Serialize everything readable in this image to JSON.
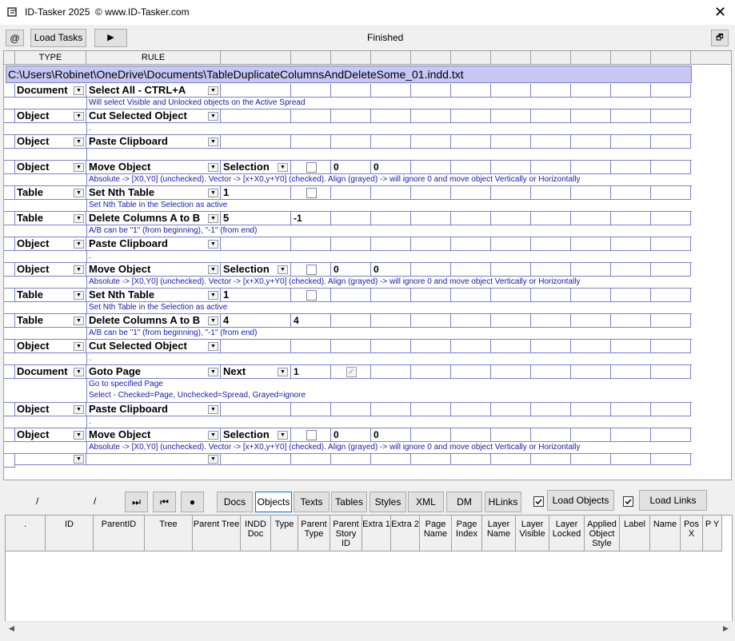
{
  "window": {
    "title": "ID-Tasker 2025  © www.ID-Tasker.com",
    "close": "✕"
  },
  "toolbar": {
    "at": "@",
    "load_tasks": "Load Tasks",
    "run": "▶",
    "status": "Finished",
    "restore": "🗗"
  },
  "grid": {
    "headers": {
      "type": "TYPE",
      "rule": "RULE"
    },
    "filepath": "C:\\Users\\Robinet\\OneDrive\\Documents\\TableDuplicateColumnsAndDeleteSome_01.indd.txt",
    "rows": [
      {
        "type": "Document",
        "rule": "Select All - CTRL+A",
        "desc": "Will select Visible and Unlocked objects on the Active Spread"
      },
      {
        "type": "Object",
        "rule": "Cut Selected Object",
        "desc": "."
      },
      {
        "type": "Object",
        "rule": "Paste Clipboard",
        "desc": ""
      },
      {
        "type": "Object",
        "rule": "Move Object",
        "param": "Selection",
        "v1": "0",
        "v2": "0",
        "desc": "Absolute -> [X0,Y0] (unchecked). Vector -> [x+X0,y+Y0] (checked). Align (grayed) -> will ignore 0 and move object Vertically or Horizontally"
      },
      {
        "type": "Table",
        "rule": "Set Nth Table",
        "param": "1",
        "desc": "Set Nth Table in the Selection as active"
      },
      {
        "type": "Table",
        "rule": "Delete Columns A to B",
        "param": "5",
        "v0": "-1",
        "desc": "A/B can be \"1\" (from beginning), \"-1\" (from end)"
      },
      {
        "type": "Object",
        "rule": "Paste Clipboard",
        "desc": "."
      },
      {
        "type": "Object",
        "rule": "Move Object",
        "param": "Selection",
        "v1": "0",
        "v2": "0",
        "desc": "Absolute -> [X0,Y0] (unchecked). Vector -> [x+X0,y+Y0] (checked). Align (grayed) -> will ignore 0 and move object Vertically or Horizontally"
      },
      {
        "type": "Table",
        "rule": "Set Nth Table",
        "param": "1",
        "desc": "Set Nth Table in the Selection as active"
      },
      {
        "type": "Table",
        "rule": "Delete Columns A to B",
        "param": "4",
        "v0": "4",
        "desc": "A/B can be \"1\" (from beginning), \"-1\" (from end)"
      },
      {
        "type": "Object",
        "rule": "Cut Selected Object",
        "desc": "."
      },
      {
        "type": "Document",
        "rule": "Goto Page",
        "param": "Next",
        "v0": "1",
        "desc": "Go to specified Page",
        "desc2": "Select - Checked=Page, Unchecked=Spread, Grayed=ignore"
      },
      {
        "type": "Object",
        "rule": "Paste Clipboard",
        "desc": "."
      },
      {
        "type": "Object",
        "rule": "Move Object",
        "param": "Selection",
        "v1": "0",
        "v2": "0",
        "desc": "Absolute -> [X0,Y0] (unchecked). Vector -> [x+X0,y+Y0] (checked). Align (grayed) -> will ignore 0 and move object Vertically or Horizontally"
      }
    ]
  },
  "bottom": {
    "slash1": "/",
    "slash2": "/",
    "nav": {
      "last": "⏭",
      "first": "⏮",
      "record": "●"
    },
    "tabs": [
      "Docs",
      "Objects",
      "Texts",
      "Tables",
      "Styles",
      "XML",
      "DM",
      "HLinks"
    ],
    "load_objects": "Load Objects",
    "load_links": "Load Links",
    "columns": [
      ".",
      "ID",
      "ParentID",
      "Tree",
      "Parent Tree",
      "INDD Doc",
      "Type",
      "Parent Type",
      "Parent Story ID",
      "Extra 1",
      "Extra 2",
      "Page Name",
      "Page Index",
      "Layer Name",
      "Layer Visible",
      "Layer Locked",
      "Applied Object Style",
      "Label",
      "Name",
      "Pos X",
      "P Y"
    ]
  }
}
